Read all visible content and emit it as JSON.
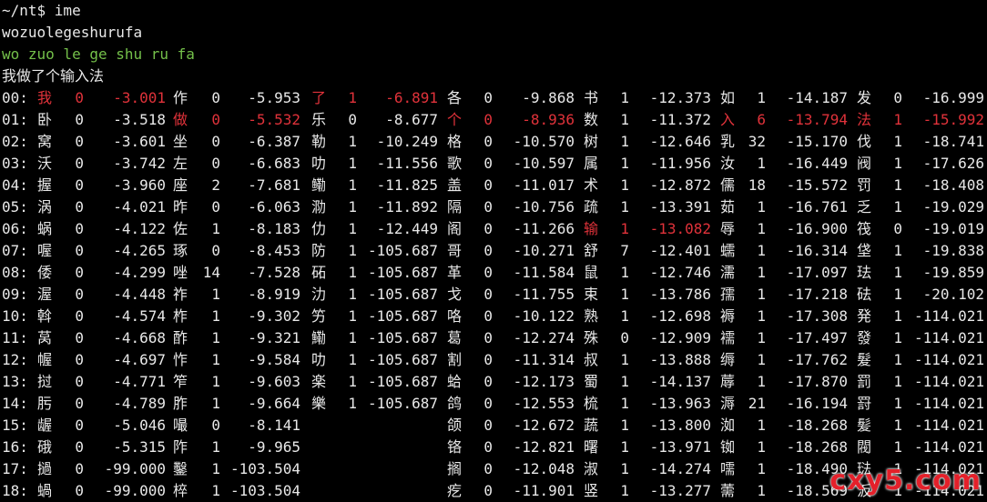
{
  "terminal": {
    "prompt_line": "~/nt$ ime",
    "input_text": "wozuolegeshurufa",
    "segmentation": "wo zuo le ge shu ru fa",
    "result_sentence": "我做了个输入法"
  },
  "candidate_rows": [
    {
      "idx": "00:",
      "cols": [
        [
          "我",
          "0",
          "-3.001",
          1
        ],
        [
          "作",
          "0",
          "-5.953",
          0
        ],
        [
          "了",
          "1",
          "-6.891",
          1
        ],
        [
          "各",
          "0",
          "-9.868",
          0
        ],
        [
          "书",
          "1",
          "-12.373",
          0
        ],
        [
          "如",
          "1",
          "-14.187",
          0
        ],
        [
          "发",
          "0",
          "-16.999",
          0
        ]
      ]
    },
    {
      "idx": "01:",
      "cols": [
        [
          "卧",
          "0",
          "-3.518",
          0
        ],
        [
          "做",
          "0",
          "-5.532",
          1
        ],
        [
          "乐",
          "0",
          "-8.677",
          0
        ],
        [
          "个",
          "0",
          "-8.936",
          1
        ],
        [
          "数",
          "1",
          "-11.372",
          0
        ],
        [
          "入",
          "6",
          "-13.794",
          1
        ],
        [
          "法",
          "1",
          "-15.992",
          1
        ]
      ]
    },
    {
      "idx": "02:",
      "cols": [
        [
          "窝",
          "0",
          "-3.601",
          0
        ],
        [
          "坐",
          "0",
          "-6.387",
          0
        ],
        [
          "勒",
          "1",
          "-10.249",
          0
        ],
        [
          "格",
          "0",
          "-10.570",
          0
        ],
        [
          "树",
          "1",
          "-12.646",
          0
        ],
        [
          "乳",
          "32",
          "-15.170",
          0
        ],
        [
          "伐",
          "1",
          "-18.741",
          0
        ]
      ]
    },
    {
      "idx": "03:",
      "cols": [
        [
          "沃",
          "0",
          "-3.742",
          0
        ],
        [
          "左",
          "0",
          "-6.683",
          0
        ],
        [
          "叻",
          "1",
          "-11.556",
          0
        ],
        [
          "歌",
          "0",
          "-10.597",
          0
        ],
        [
          "属",
          "1",
          "-11.956",
          0
        ],
        [
          "汝",
          "1",
          "-16.449",
          0
        ],
        [
          "阀",
          "1",
          "-17.626",
          0
        ]
      ]
    },
    {
      "idx": "04:",
      "cols": [
        [
          "握",
          "0",
          "-3.960",
          0
        ],
        [
          "座",
          "2",
          "-7.681",
          0
        ],
        [
          "鳓",
          "1",
          "-11.825",
          0
        ],
        [
          "盖",
          "0",
          "-11.017",
          0
        ],
        [
          "术",
          "1",
          "-12.872",
          0
        ],
        [
          "儒",
          "18",
          "-15.572",
          0
        ],
        [
          "罚",
          "1",
          "-18.408",
          0
        ]
      ]
    },
    {
      "idx": "05:",
      "cols": [
        [
          "涡",
          "0",
          "-4.021",
          0
        ],
        [
          "昨",
          "0",
          "-6.063",
          0
        ],
        [
          "泐",
          "1",
          "-11.892",
          0
        ],
        [
          "隔",
          "0",
          "-10.756",
          0
        ],
        [
          "疏",
          "1",
          "-13.391",
          0
        ],
        [
          "茹",
          "1",
          "-16.761",
          0
        ],
        [
          "乏",
          "1",
          "-19.029",
          0
        ]
      ]
    },
    {
      "idx": "06:",
      "cols": [
        [
          "蜗",
          "0",
          "-4.122",
          0
        ],
        [
          "佐",
          "1",
          "-8.183",
          0
        ],
        [
          "仂",
          "1",
          "-12.449",
          0
        ],
        [
          "阁",
          "0",
          "-11.266",
          0
        ],
        [
          "输",
          "1",
          "-13.082",
          1
        ],
        [
          "辱",
          "1",
          "-16.900",
          0
        ],
        [
          "筏",
          "0",
          "-19.019",
          0
        ]
      ]
    },
    {
      "idx": "07:",
      "cols": [
        [
          "喔",
          "0",
          "-4.265",
          0
        ],
        [
          "琢",
          "0",
          "-8.453",
          0
        ],
        [
          "防",
          "1",
          "-105.687",
          0
        ],
        [
          "哥",
          "0",
          "-10.271",
          0
        ],
        [
          "舒",
          "7",
          "-12.401",
          0
        ],
        [
          "蠕",
          "1",
          "-16.314",
          0
        ],
        [
          "垡",
          "1",
          "-19.838",
          0
        ]
      ]
    },
    {
      "idx": "08:",
      "cols": [
        [
          "倭",
          "0",
          "-4.299",
          0
        ],
        [
          "唑",
          "14",
          "-7.528",
          0
        ],
        [
          "砳",
          "1",
          "-105.687",
          0
        ],
        [
          "革",
          "0",
          "-11.584",
          0
        ],
        [
          "鼠",
          "1",
          "-12.746",
          0
        ],
        [
          "濡",
          "1",
          "-17.097",
          0
        ],
        [
          "珐",
          "1",
          "-19.859",
          0
        ]
      ]
    },
    {
      "idx": "09:",
      "cols": [
        [
          "渥",
          "0",
          "-4.448",
          0
        ],
        [
          "祚",
          "1",
          "-8.919",
          0
        ],
        [
          "氻",
          "1",
          "-105.687",
          0
        ],
        [
          "戈",
          "0",
          "-11.755",
          0
        ],
        [
          "束",
          "1",
          "-13.786",
          0
        ],
        [
          "孺",
          "1",
          "-17.218",
          0
        ],
        [
          "砝",
          "1",
          "-20.102",
          0
        ]
      ]
    },
    {
      "idx": "10:",
      "cols": [
        [
          "斡",
          "0",
          "-4.574",
          0
        ],
        [
          "柞",
          "1",
          "-9.302",
          0
        ],
        [
          "竻",
          "1",
          "-105.687",
          0
        ],
        [
          "咯",
          "0",
          "-10.122",
          0
        ],
        [
          "熟",
          "1",
          "-12.698",
          0
        ],
        [
          "褥",
          "1",
          "-17.308",
          0
        ],
        [
          "発",
          "1",
          "-114.021",
          0
        ]
      ]
    },
    {
      "idx": "11:",
      "cols": [
        [
          "莴",
          "0",
          "-4.668",
          0
        ],
        [
          "酢",
          "1",
          "-9.321",
          0
        ],
        [
          "鰳",
          "1",
          "-105.687",
          0
        ],
        [
          "葛",
          "0",
          "-12.274",
          0
        ],
        [
          "殊",
          "0",
          "-12.909",
          0
        ],
        [
          "襦",
          "1",
          "-17.497",
          0
        ],
        [
          "發",
          "1",
          "-114.021",
          0
        ]
      ]
    },
    {
      "idx": "12:",
      "cols": [
        [
          "幄",
          "0",
          "-4.697",
          0
        ],
        [
          "怍",
          "1",
          "-9.584",
          0
        ],
        [
          "叻",
          "1",
          "-105.687",
          0
        ],
        [
          "割",
          "0",
          "-11.314",
          0
        ],
        [
          "叔",
          "1",
          "-13.888",
          0
        ],
        [
          "缛",
          "1",
          "-17.762",
          0
        ],
        [
          "髮",
          "1",
          "-114.021",
          0
        ]
      ]
    },
    {
      "idx": "13:",
      "cols": [
        [
          "挝",
          "0",
          "-4.771",
          0
        ],
        [
          "笮",
          "1",
          "-9.603",
          0
        ],
        [
          "楽",
          "1",
          "-105.687",
          0
        ],
        [
          "蛤",
          "0",
          "-12.173",
          0
        ],
        [
          "蜀",
          "1",
          "-14.137",
          0
        ],
        [
          "蓐",
          "1",
          "-17.870",
          0
        ],
        [
          "罰",
          "1",
          "-114.021",
          0
        ]
      ]
    },
    {
      "idx": "14:",
      "cols": [
        [
          "肟",
          "0",
          "-4.789",
          0
        ],
        [
          "胙",
          "1",
          "-9.664",
          0
        ],
        [
          "樂",
          "1",
          "-105.687",
          0
        ],
        [
          "鸽",
          "0",
          "-12.553",
          0
        ],
        [
          "梳",
          "1",
          "-13.963",
          0
        ],
        [
          "溽",
          "21",
          "-16.194",
          0
        ],
        [
          "罸",
          "1",
          "-114.021",
          0
        ]
      ]
    },
    {
      "idx": "15:",
      "cols": [
        [
          "龌",
          "0",
          "-5.046",
          0
        ],
        [
          "嘬",
          "0",
          "-8.141",
          0
        ],
        null,
        [
          "颌",
          "0",
          "-12.672",
          0
        ],
        [
          "蔬",
          "1",
          "-13.800",
          0
        ],
        [
          "洳",
          "1",
          "-18.268",
          0
        ],
        [
          "髪",
          "1",
          "-114.021",
          0
        ]
      ]
    },
    {
      "idx": "16:",
      "cols": [
        [
          "硪",
          "0",
          "-5.315",
          0
        ],
        [
          "阼",
          "1",
          "-9.965",
          0
        ],
        null,
        [
          "铬",
          "0",
          "-12.821",
          0
        ],
        [
          "曙",
          "1",
          "-13.971",
          0
        ],
        [
          "铷",
          "1",
          "-18.268",
          0
        ],
        [
          "閥",
          "1",
          "-114.021",
          0
        ]
      ]
    },
    {
      "idx": "17:",
      "cols": [
        [
          "撾",
          "0",
          "-99.000",
          0
        ],
        [
          "鑿",
          "1",
          "-103.504",
          0
        ],
        null,
        [
          "搁",
          "0",
          "-12.048",
          0
        ],
        [
          "淑",
          "1",
          "-14.274",
          0
        ],
        [
          "嚅",
          "1",
          "-18.490",
          0
        ],
        [
          "琺",
          "1",
          "-114.021",
          0
        ]
      ]
    },
    {
      "idx": "18:",
      "cols": [
        [
          "蝸",
          "0",
          "-99.000",
          0
        ],
        [
          "椊",
          "1",
          "-103.504",
          0
        ],
        null,
        [
          "疙",
          "0",
          "-11.901",
          0
        ],
        [
          "竖",
          "1",
          "-13.277",
          0
        ],
        [
          "薷",
          "1",
          "-18.569",
          0
        ],
        [
          "汳",
          "1",
          "-114.021",
          0
        ]
      ]
    }
  ],
  "watermark": "cxy5.com",
  "colors": {
    "background": "#000000",
    "foreground": "#e8e8e8",
    "segmentation_green": "#74c04a",
    "selected_red": "#e0323a"
  }
}
